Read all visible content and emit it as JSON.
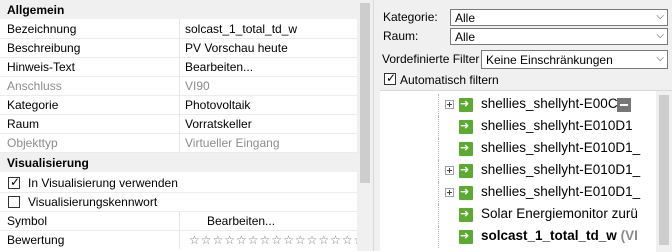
{
  "props": {
    "section_general": "Allgemein",
    "rows": [
      {
        "key": "Bezeichnung",
        "value": "solcast_1_total_td_w",
        "disabled": false
      },
      {
        "key": "Beschreibung",
        "value": "PV Vorschau heute",
        "disabled": false
      },
      {
        "key": "Hinweis-Text",
        "value": "Bearbeiten...",
        "disabled": false
      },
      {
        "key": "Anschluss",
        "value": "VI90",
        "disabled": true
      },
      {
        "key": "Kategorie",
        "value": "Photovoltaik",
        "disabled": false
      },
      {
        "key": "Raum",
        "value": "Vorratskeller",
        "disabled": false
      },
      {
        "key": "Objekttyp",
        "value": "Virtueller Eingang",
        "disabled": true
      }
    ],
    "section_vis": "Visualisierung",
    "vis_use_label": "In Visualisierung verwenden",
    "vis_use_checked": true,
    "vis_kennwort_label": "Visualisierungskennwort",
    "vis_kennwort_checked": false,
    "symbol_key": "Symbol",
    "symbol_value": "Bearbeiten...",
    "rating_key": "Bewertung",
    "rating_stars": "☆☆☆☆☆☆☆☆☆☆☆☆☆☆☆",
    "rating_value": 0
  },
  "filters": {
    "kategorie_label": "Kategorie:",
    "kategorie_value": "Alle",
    "raum_label": "Raum:",
    "raum_value": "Alle",
    "vordef_label": "Vordefinierte Filter",
    "vordef_value": "Keine Einschränkungen",
    "auto_label": "Automatisch filtern",
    "auto_checked": true
  },
  "tree": {
    "items": [
      {
        "label": "shellies_shellyht-E00C",
        "expandable": true
      },
      {
        "label": "shellies_shellyht-E010D1",
        "expandable": false
      },
      {
        "label": "shellies_shellyht-E010D1_",
        "expandable": false
      },
      {
        "label": "shellies_shellyht-E010D1_",
        "expandable": true
      },
      {
        "label": "shellies_shellyht-E010D1_",
        "expandable": true
      },
      {
        "label": "Solar Energiemonitor zurü",
        "expandable": false
      },
      {
        "label": "solcast_1_total_td_w",
        "expandable": false,
        "suffix": "(VI"
      }
    ]
  },
  "icons": {
    "item": "green-arrow-icon",
    "expand": "plus-box-icon",
    "collapse": "minus-icon",
    "dropdown": "chevron-down-icon",
    "check": "checkmark-icon"
  },
  "colors": {
    "item_icon": "#5aab2f",
    "section_bg": "#f0f0f0",
    "disabled_text": "#8c8c8c"
  }
}
